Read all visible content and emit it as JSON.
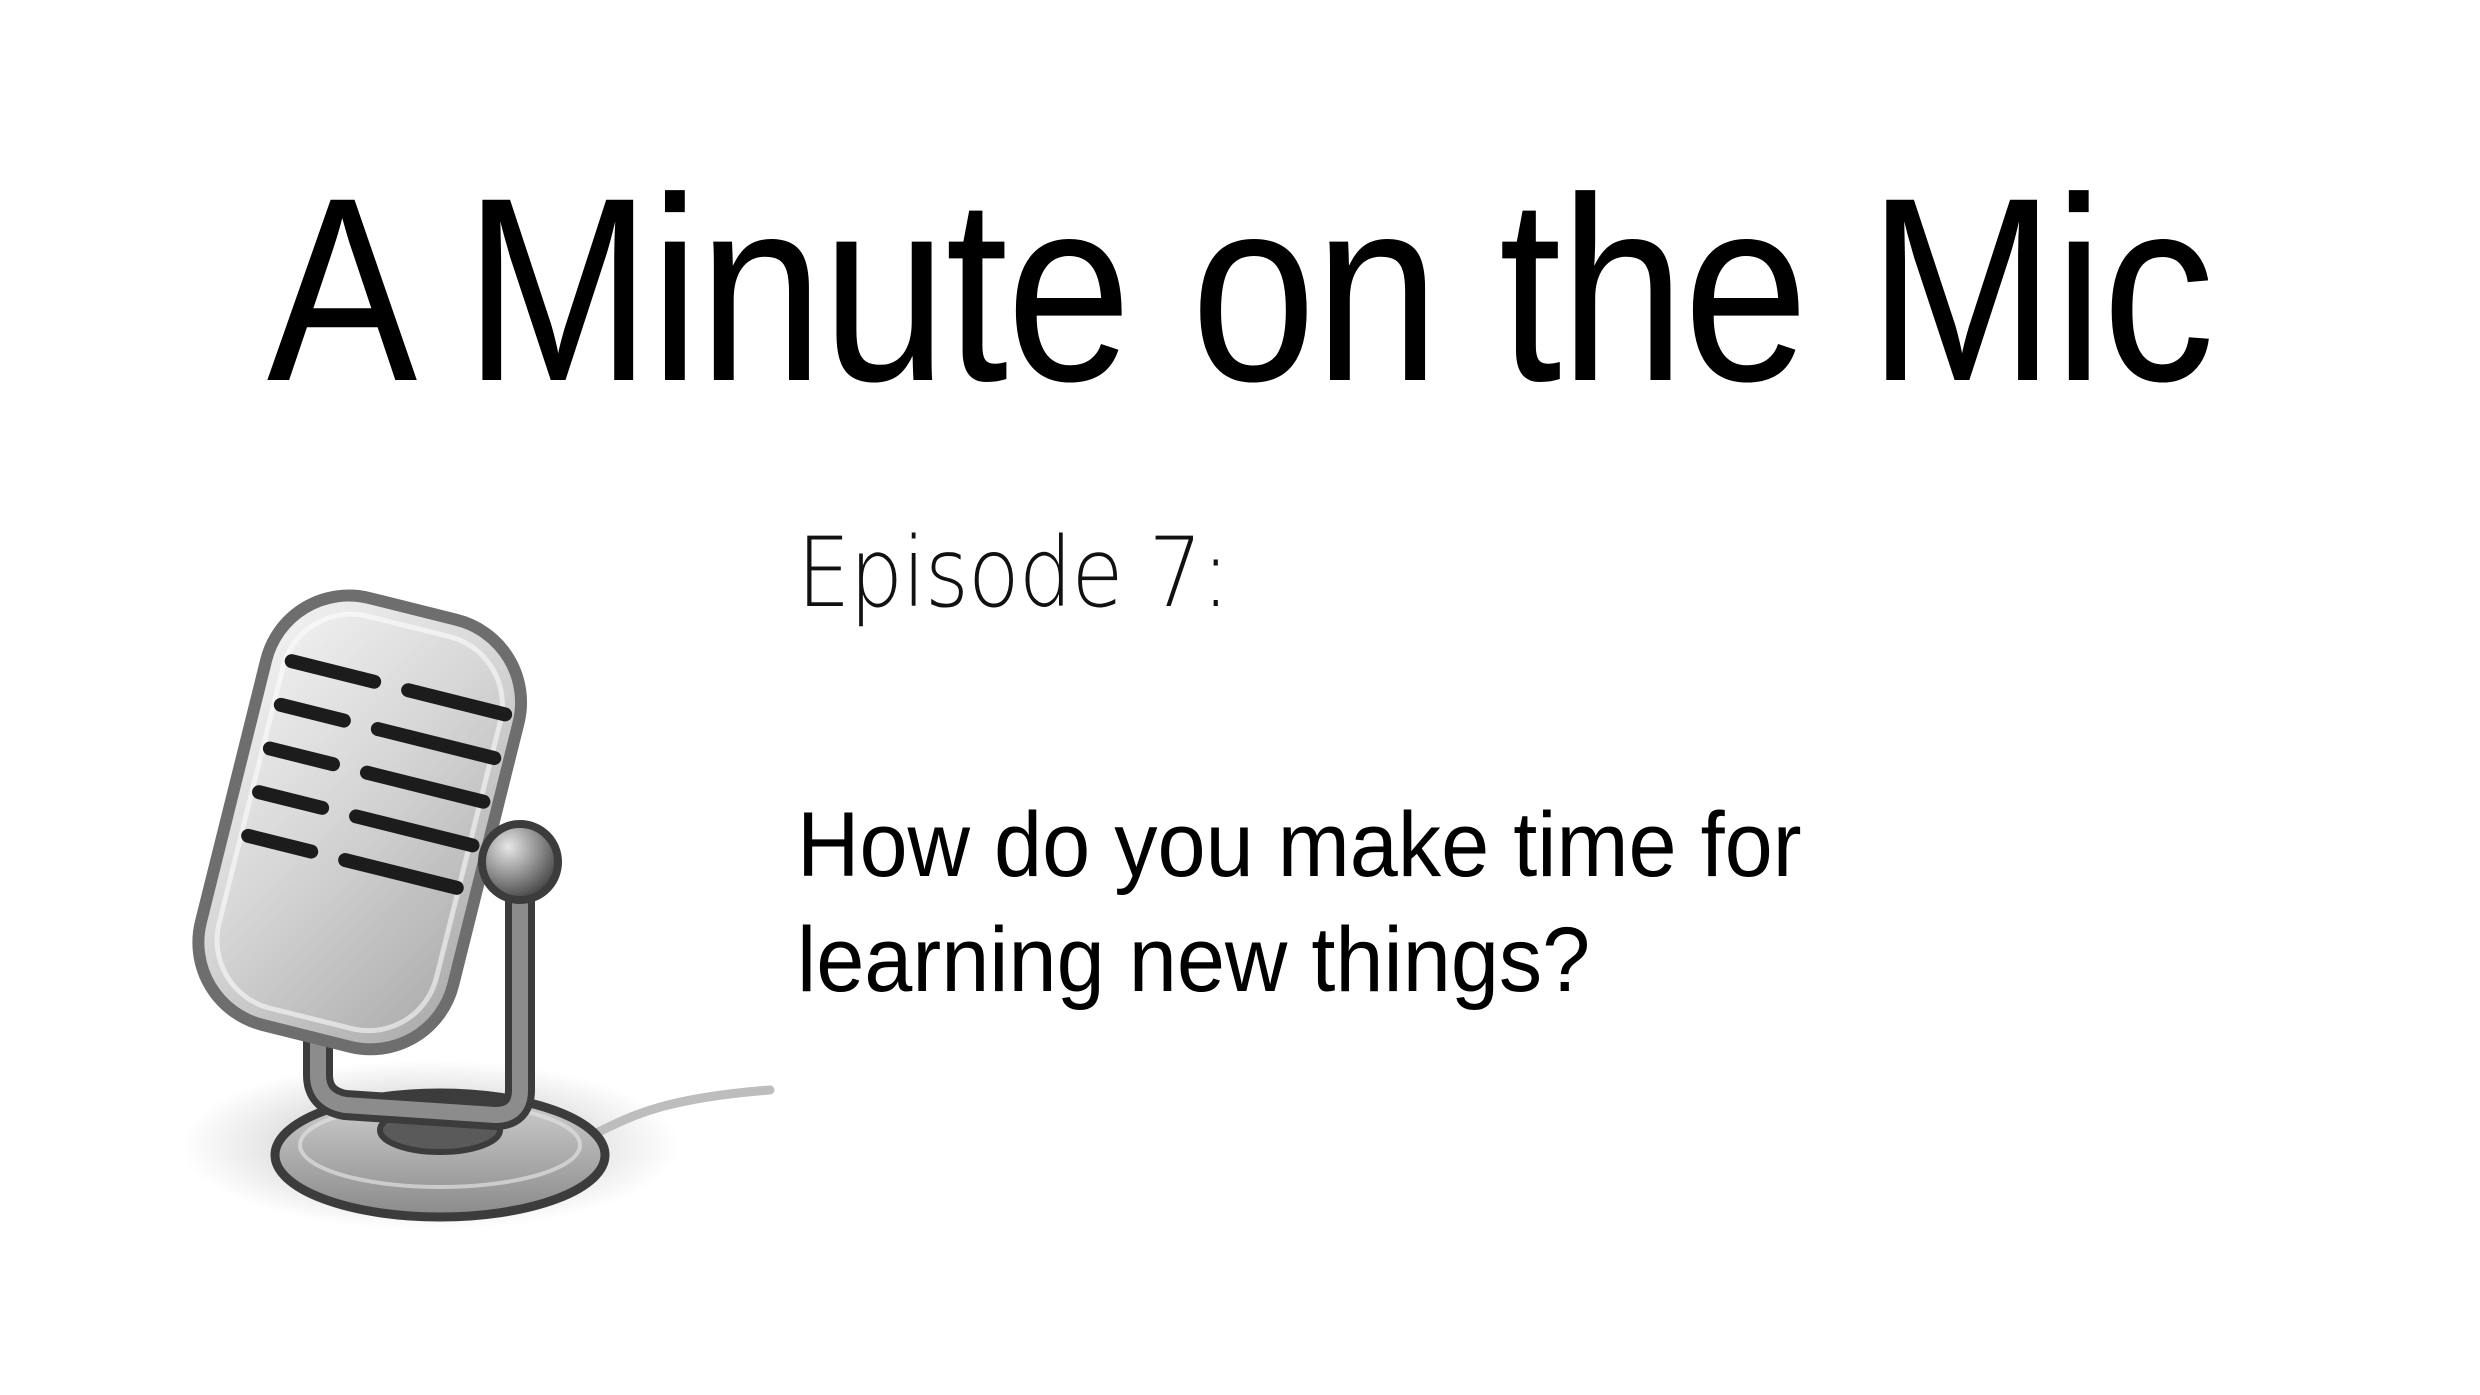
{
  "slide": {
    "title": "A Minute on the Mic",
    "episode_label": "Episode 7:",
    "question": "How do you make time for learning new things?"
  },
  "icons": {
    "microphone": "microphone-icon"
  },
  "colors": {
    "background": "#ffffff",
    "text": "#000000",
    "mic_body": "#9a9a9a",
    "mic_outline": "#4d4d4d"
  }
}
